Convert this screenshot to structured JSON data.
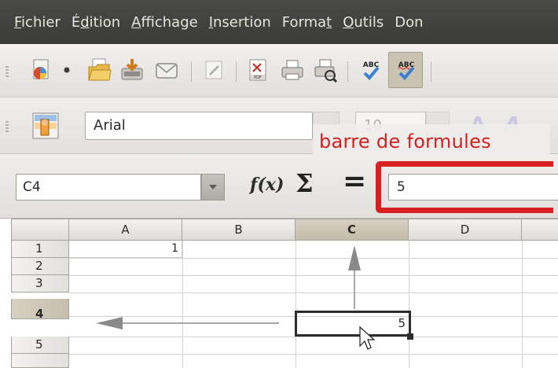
{
  "menu": [
    {
      "pre": "",
      "u": "F",
      "post": "ichier"
    },
    {
      "pre": "É",
      "u": "d",
      "post": "ition"
    },
    {
      "pre": "",
      "u": "A",
      "post": "ffichage"
    },
    {
      "pre": "",
      "u": "I",
      "post": "nsertion"
    },
    {
      "pre": "Forma",
      "u": "t",
      "post": ""
    },
    {
      "pre": "",
      "u": "O",
      "post": "utils"
    },
    {
      "pre": "Don",
      "u": "",
      "post": ""
    }
  ],
  "toolbar": {
    "icons": [
      "new-document-icon",
      "dropdown-arrow-icon",
      "open-folder-icon",
      "save-icon",
      "email-icon",
      "edit-file-icon",
      "export-pdf-icon",
      "print-icon",
      "print-preview-icon",
      "spellcheck-icon",
      "autospellcheck-icon"
    ]
  },
  "format_toolbar": {
    "font_name": "Arial",
    "font_size": "10"
  },
  "annotation": "barre de formules",
  "formula_bar": {
    "cell_reference": "C4",
    "fx_label": "f(x)",
    "sum_symbol": "Σ",
    "equals_symbol": "=",
    "content": "5"
  },
  "sheet": {
    "columns": [
      "A",
      "B",
      "C",
      "D"
    ],
    "active_column": "C",
    "rows": [
      "1",
      "2",
      "3",
      "4",
      "5"
    ],
    "active_row": "4",
    "cell_A1": "1",
    "cell_C4": "5"
  },
  "colors": {
    "annotation": "#d6201f",
    "highlight_frame": "#d92020",
    "menubar": "#3e3e3b",
    "arrow": "#8a8a8a"
  }
}
